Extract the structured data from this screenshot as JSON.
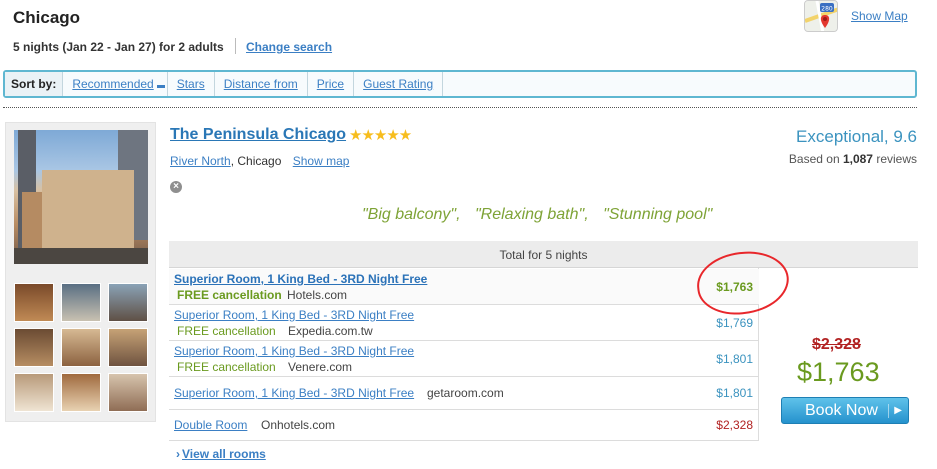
{
  "header": {
    "city": "Chicago",
    "search_summary": "5 nights (Jan 22 - Jan 27) for 2 adults",
    "change_search": "Change search",
    "show_map": "Show Map",
    "map_icon_badge": "280"
  },
  "sort": {
    "label": "Sort by:",
    "options": [
      "Recommended",
      "Stars",
      "Distance from",
      "Price",
      "Guest Rating"
    ]
  },
  "hotel": {
    "name": "The Peninsula Chicago",
    "stars": "★★★★★",
    "star_count": 5,
    "neighborhood": "River North",
    "city": ", Chicago",
    "show_map": "Show map",
    "rating": "Exceptional, 9.6",
    "reviews_prefix": "Based on ",
    "reviews_count": "1,087",
    "reviews_suffix": " reviews",
    "quotes": [
      "\"Big balcony\",",
      "\"Relaxing bath\",",
      "\"Stunning pool\""
    ]
  },
  "rates": {
    "header": "Total for 5 nights",
    "rows": [
      {
        "room": "Superior Room, 1 King Bed - 3RD Night Free",
        "free": "FREE cancellation",
        "site": "Hotels.com",
        "price": "$1,763"
      },
      {
        "room": "Superior Room, 1 King Bed - 3RD Night Free",
        "free": "FREE cancellation",
        "site": "Expedia.com.tw",
        "price": "$1,769"
      },
      {
        "room": "Superior Room, 1 King Bed - 3RD Night Free",
        "free": "FREE cancellation",
        "site": "Venere.com",
        "price": "$1,801"
      },
      {
        "room": "Superior Room, 1 King Bed - 3RD Night Free",
        "free": "",
        "site": "getaroom.com",
        "price": "$1,801"
      },
      {
        "room": "Double Room",
        "free": "",
        "site": "Onhotels.com",
        "price": "$2,328"
      }
    ],
    "old_price": "$2,328",
    "best_price": "$1,763",
    "book_now": "Book Now",
    "view_all": "View all rooms"
  },
  "colors": {
    "accent": "#3b7fc4",
    "green": "#6a9a1f",
    "red": "#b22222",
    "sortbar_border": "#5fb7d1",
    "button": "#2592cd"
  }
}
